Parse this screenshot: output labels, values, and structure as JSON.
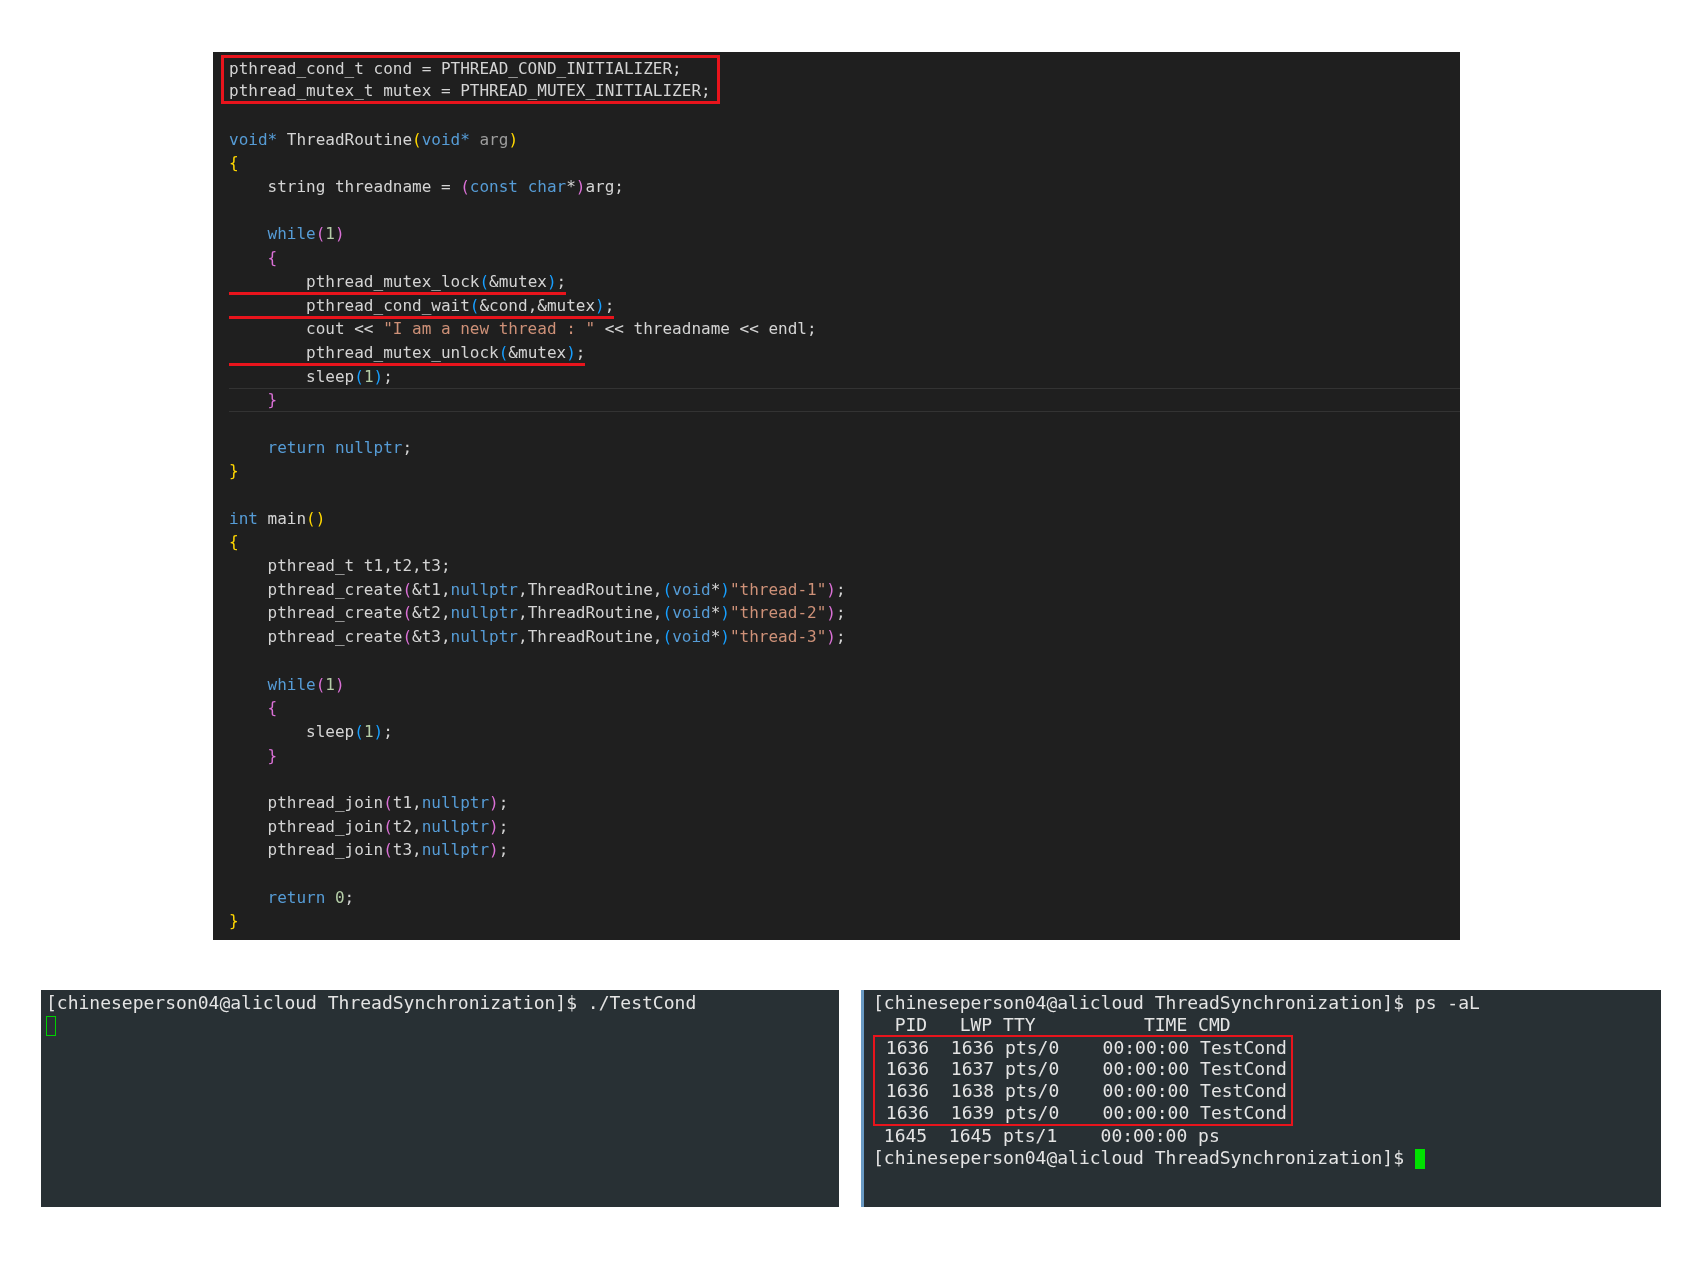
{
  "code_editor": {
    "lines": [
      {
        "kind": "highlight_box",
        "lines": [
          {
            "segments": [
              {
                "text": "pthread_cond_t cond = PTHREAD_COND_INITIALIZER;",
                "kind": "plain"
              }
            ]
          },
          {
            "segments": [
              {
                "text": "pthread_mutex_t mutex = PTHREAD_MUTEX_INITIALIZER;",
                "kind": "plain"
              }
            ]
          }
        ]
      },
      {
        "kind": "blank"
      },
      {
        "kind": "code",
        "segments": [
          {
            "text": "void*",
            "kind": "keyword"
          },
          {
            "text": " ThreadRoutine",
            "kind": "plain"
          },
          {
            "text": "(",
            "kind": "bracket1"
          },
          {
            "text": "void*",
            "kind": "keyword"
          },
          {
            "text": " arg",
            "kind": "faded"
          },
          {
            "text": ")",
            "kind": "bracket1"
          }
        ]
      },
      {
        "kind": "code",
        "segments": [
          {
            "text": "{",
            "kind": "bracket1"
          }
        ]
      },
      {
        "kind": "code",
        "segments": [
          {
            "text": "    string threadname = ",
            "kind": "plain"
          },
          {
            "text": "(",
            "kind": "bracket2"
          },
          {
            "text": "const char",
            "kind": "keyword"
          },
          {
            "text": "*",
            "kind": "plain"
          },
          {
            "text": ")",
            "kind": "bracket2"
          },
          {
            "text": "arg;",
            "kind": "plain"
          }
        ]
      },
      {
        "kind": "blank"
      },
      {
        "kind": "code",
        "segments": [
          {
            "text": "    while",
            "kind": "keyword"
          },
          {
            "text": "(",
            "kind": "bracket2"
          },
          {
            "text": "1",
            "kind": "number"
          },
          {
            "text": ")",
            "kind": "bracket2"
          }
        ]
      },
      {
        "kind": "code",
        "segments": [
          {
            "text": "    {",
            "kind": "bracket2"
          }
        ]
      },
      {
        "kind": "underlined",
        "segments": [
          {
            "text": "        pthread_mutex_lock",
            "kind": "plain"
          },
          {
            "text": "(",
            "kind": "bracket3"
          },
          {
            "text": "&mutex",
            "kind": "plain"
          },
          {
            "text": ")",
            "kind": "bracket3"
          },
          {
            "text": ";",
            "kind": "plain"
          }
        ]
      },
      {
        "kind": "underlined",
        "segments": [
          {
            "text": "        pthread_cond_wait",
            "kind": "plain"
          },
          {
            "text": "(",
            "kind": "bracket3"
          },
          {
            "text": "&cond,&mutex",
            "kind": "plain"
          },
          {
            "text": ")",
            "kind": "bracket3"
          },
          {
            "text": ";",
            "kind": "plain"
          }
        ]
      },
      {
        "kind": "code",
        "segments": [
          {
            "text": "        cout << ",
            "kind": "plain"
          },
          {
            "text": "\"I am a new thread : \"",
            "kind": "string"
          },
          {
            "text": " << threadname << endl;",
            "kind": "plain"
          }
        ]
      },
      {
        "kind": "underlined",
        "segments": [
          {
            "text": "        pthread_mutex_unlock",
            "kind": "plain"
          },
          {
            "text": "(",
            "kind": "bracket3"
          },
          {
            "text": "&mutex",
            "kind": "plain"
          },
          {
            "text": ")",
            "kind": "bracket3"
          },
          {
            "text": ";",
            "kind": "plain"
          }
        ]
      },
      {
        "kind": "code",
        "segments": [
          {
            "text": "        sleep",
            "kind": "plain"
          },
          {
            "text": "(",
            "kind": "bracket3"
          },
          {
            "text": "1",
            "kind": "number"
          },
          {
            "text": ")",
            "kind": "bracket3"
          },
          {
            "text": ";",
            "kind": "plain"
          }
        ]
      },
      {
        "kind": "current",
        "segments": [
          {
            "text": "    }",
            "kind": "bracket2"
          }
        ]
      },
      {
        "kind": "blank"
      },
      {
        "kind": "code",
        "segments": [
          {
            "text": "    return nullptr",
            "kind": "keyword"
          },
          {
            "text": ";",
            "kind": "plain"
          }
        ]
      },
      {
        "kind": "code",
        "segments": [
          {
            "text": "}",
            "kind": "bracket1"
          }
        ]
      },
      {
        "kind": "blank"
      },
      {
        "kind": "code",
        "segments": [
          {
            "text": "int",
            "kind": "keyword"
          },
          {
            "text": " main",
            "kind": "plain"
          },
          {
            "text": "()",
            "kind": "bracket1"
          }
        ]
      },
      {
        "kind": "code",
        "segments": [
          {
            "text": "{",
            "kind": "bracket1"
          }
        ]
      },
      {
        "kind": "code",
        "segments": [
          {
            "text": "    pthread_t t1,t2,t3;",
            "kind": "plain"
          }
        ]
      },
      {
        "kind": "code",
        "segments": [
          {
            "text": "    pthread_create",
            "kind": "plain"
          },
          {
            "text": "(",
            "kind": "bracket2"
          },
          {
            "text": "&t1,",
            "kind": "plain"
          },
          {
            "text": "nullptr",
            "kind": "keyword"
          },
          {
            "text": ",ThreadRoutine,",
            "kind": "plain"
          },
          {
            "text": "(",
            "kind": "bracket3"
          },
          {
            "text": "void",
            "kind": "keyword"
          },
          {
            "text": "*",
            "kind": "plain"
          },
          {
            "text": ")",
            "kind": "bracket3"
          },
          {
            "text": "\"thread-1\"",
            "kind": "string"
          },
          {
            "text": ")",
            "kind": "bracket2"
          },
          {
            "text": ";",
            "kind": "plain"
          }
        ]
      },
      {
        "kind": "code",
        "segments": [
          {
            "text": "    pthread_create",
            "kind": "plain"
          },
          {
            "text": "(",
            "kind": "bracket2"
          },
          {
            "text": "&t2,",
            "kind": "plain"
          },
          {
            "text": "nullptr",
            "kind": "keyword"
          },
          {
            "text": ",ThreadRoutine,",
            "kind": "plain"
          },
          {
            "text": "(",
            "kind": "bracket3"
          },
          {
            "text": "void",
            "kind": "keyword"
          },
          {
            "text": "*",
            "kind": "plain"
          },
          {
            "text": ")",
            "kind": "bracket3"
          },
          {
            "text": "\"thread-2\"",
            "kind": "string"
          },
          {
            "text": ")",
            "kind": "bracket2"
          },
          {
            "text": ";",
            "kind": "plain"
          }
        ]
      },
      {
        "kind": "code",
        "segments": [
          {
            "text": "    pthread_create",
            "kind": "plain"
          },
          {
            "text": "(",
            "kind": "bracket2"
          },
          {
            "text": "&t3,",
            "kind": "plain"
          },
          {
            "text": "nullptr",
            "kind": "keyword"
          },
          {
            "text": ",ThreadRoutine,",
            "kind": "plain"
          },
          {
            "text": "(",
            "kind": "bracket3"
          },
          {
            "text": "void",
            "kind": "keyword"
          },
          {
            "text": "*",
            "kind": "plain"
          },
          {
            "text": ")",
            "kind": "bracket3"
          },
          {
            "text": "\"thread-3\"",
            "kind": "string"
          },
          {
            "text": ")",
            "kind": "bracket2"
          },
          {
            "text": ";",
            "kind": "plain"
          }
        ]
      },
      {
        "kind": "blank"
      },
      {
        "kind": "code",
        "segments": [
          {
            "text": "    while",
            "kind": "keyword"
          },
          {
            "text": "(",
            "kind": "bracket2"
          },
          {
            "text": "1",
            "kind": "number"
          },
          {
            "text": ")",
            "kind": "bracket2"
          }
        ]
      },
      {
        "kind": "code",
        "segments": [
          {
            "text": "    {",
            "kind": "bracket2"
          }
        ]
      },
      {
        "kind": "code",
        "segments": [
          {
            "text": "        sleep",
            "kind": "plain"
          },
          {
            "text": "(",
            "kind": "bracket3"
          },
          {
            "text": "1",
            "kind": "number"
          },
          {
            "text": ")",
            "kind": "bracket3"
          },
          {
            "text": ";",
            "kind": "plain"
          }
        ]
      },
      {
        "kind": "code",
        "segments": [
          {
            "text": "    }",
            "kind": "bracket2"
          }
        ]
      },
      {
        "kind": "blank"
      },
      {
        "kind": "code",
        "segments": [
          {
            "text": "    pthread_join",
            "kind": "plain"
          },
          {
            "text": "(",
            "kind": "bracket2"
          },
          {
            "text": "t1,",
            "kind": "plain"
          },
          {
            "text": "nullptr",
            "kind": "keyword"
          },
          {
            "text": ")",
            "kind": "bracket2"
          },
          {
            "text": ";",
            "kind": "plain"
          }
        ]
      },
      {
        "kind": "code",
        "segments": [
          {
            "text": "    pthread_join",
            "kind": "plain"
          },
          {
            "text": "(",
            "kind": "bracket2"
          },
          {
            "text": "t2,",
            "kind": "plain"
          },
          {
            "text": "nullptr",
            "kind": "keyword"
          },
          {
            "text": ")",
            "kind": "bracket2"
          },
          {
            "text": ";",
            "kind": "plain"
          }
        ]
      },
      {
        "kind": "code",
        "segments": [
          {
            "text": "    pthread_join",
            "kind": "plain"
          },
          {
            "text": "(",
            "kind": "bracket2"
          },
          {
            "text": "t3,",
            "kind": "plain"
          },
          {
            "text": "nullptr",
            "kind": "keyword"
          },
          {
            "text": ")",
            "kind": "bracket2"
          },
          {
            "text": ";",
            "kind": "plain"
          }
        ]
      },
      {
        "kind": "blank"
      },
      {
        "kind": "code",
        "segments": [
          {
            "text": "    return ",
            "kind": "keyword"
          },
          {
            "text": "0",
            "kind": "number"
          },
          {
            "text": ";",
            "kind": "plain"
          }
        ]
      },
      {
        "kind": "code",
        "segments": [
          {
            "text": "}",
            "kind": "bracket1"
          }
        ]
      }
    ]
  },
  "terminals": [
    {
      "kind": "idle",
      "lines": [
        {
          "kind": "text",
          "text": "[chineseperson04@alicloud ThreadSynchronization]$ ./TestCond"
        }
      ]
    },
    {
      "kind": "prompt",
      "lines": [
        {
          "kind": "text",
          "text": "[chineseperson04@alicloud ThreadSynchronization]$ ps -aL"
        },
        {
          "kind": "text",
          "text": "  PID   LWP TTY          TIME CMD"
        },
        {
          "kind": "highlight_box",
          "lines": [
            {
              "text": " 1636  1636 pts/0    00:00:00 TestCond"
            },
            {
              "text": " 1636  1637 pts/0    00:00:00 TestCond"
            },
            {
              "text": " 1636  1638 pts/0    00:00:00 TestCond"
            },
            {
              "text": " 1636  1639 pts/0    00:00:00 TestCond"
            }
          ]
        },
        {
          "kind": "text",
          "text": " 1645  1645 pts/1    00:00:00 ps"
        },
        {
          "kind": "text",
          "text": "[chineseperson04@alicloud ThreadSynchronization]$ "
        }
      ]
    }
  ]
}
